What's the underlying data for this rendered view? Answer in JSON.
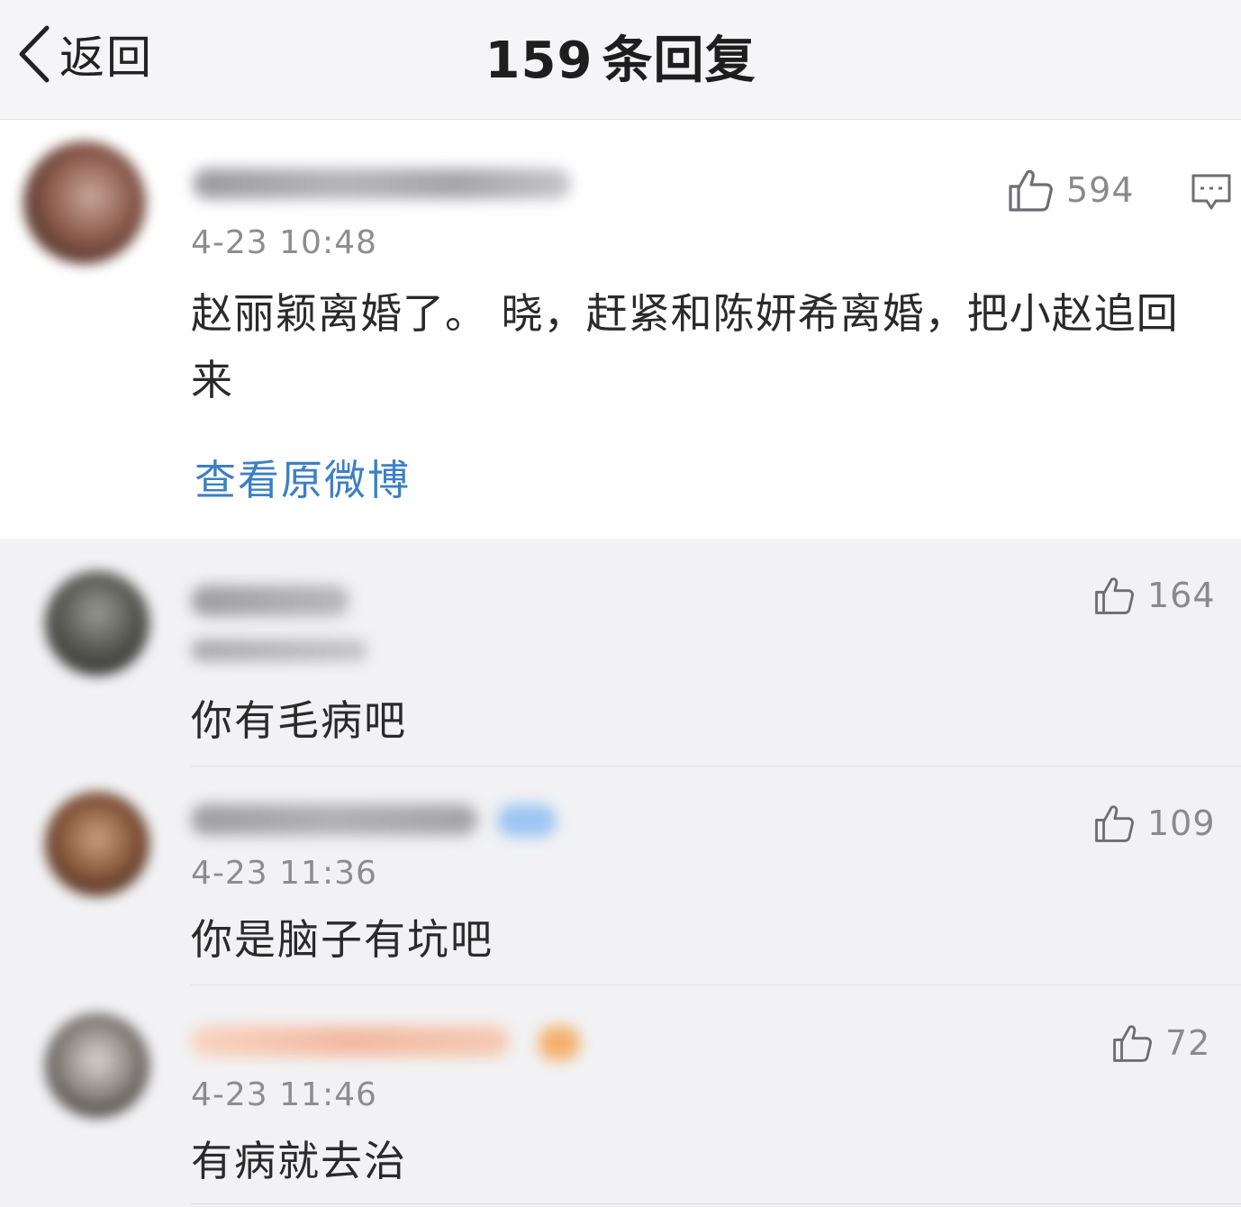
{
  "nav": {
    "back_label": "返回",
    "reply_count": "159",
    "title_suffix": "条回复"
  },
  "post": {
    "timestamp": "4-23 10:48",
    "text": "赵丽颖离婚了。 晓，赶紧和陈妍希离婚，把小赵追回来",
    "likes": "594",
    "view_original_label": "查看原微博"
  },
  "replies": [
    {
      "timestamp": "",
      "text": "你有毛病吧",
      "likes": "164"
    },
    {
      "timestamp": "4-23 11:36",
      "text": "你是脑子有坑吧",
      "likes": "109"
    },
    {
      "timestamp": "4-23 11:46",
      "text": "有病就去治",
      "likes": "72"
    }
  ],
  "icons": {
    "back": "chevron-left-icon",
    "like": "thumbs-up-icon",
    "comment": "comment-bubble-icon",
    "verified": "verified-badge-icon"
  },
  "colors": {
    "link": "#3d7fc4",
    "text": "#2a2a2a",
    "muted": "#8d8d8f",
    "badge_blue": "#9cc5f2",
    "badge_orange": "#f4b06c"
  }
}
